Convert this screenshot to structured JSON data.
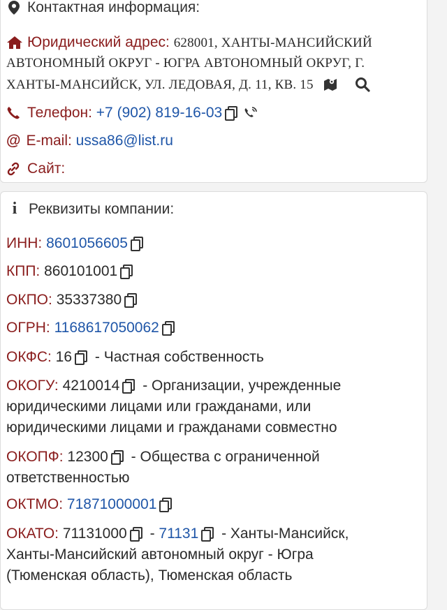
{
  "contact": {
    "header": "Контактная информация:",
    "address_label": "Юридический адрес:",
    "address_line1": "628001, ХАНТЫ-МАНСИЙСКИЙ",
    "address_line2": "АВТОНОМНЫЙ ОКРУГ - ЮГРА АВТОНОМНЫЙ ОКРУГ, Г.",
    "address_line3": "ХАНТЫ-МАНСИЙСК, УЛ. ЛЕДОВАЯ, Д. 11, КВ. 15",
    "phone_label": "Телефон:",
    "phone_value": "+7 (902) 819-16-03",
    "email_label": "E-mail:",
    "email_value": "ussa86@list.ru",
    "site_label": "Сайт:"
  },
  "requisites": {
    "header": "Реквизиты компании:",
    "inn_label": "ИНН:",
    "inn_value": "8601056605",
    "kpp_label": "КПП:",
    "kpp_value": "860101001",
    "okpo_label": "ОКПО:",
    "okpo_value": "35337380",
    "ogrn_label": "ОГРН:",
    "ogrn_value": "1168617050062",
    "okfs_label": "ОКФС:",
    "okfs_value": "16",
    "okfs_desc": "- Частная собственность",
    "okogu_label": "ОКОГУ:",
    "okogu_value": "4210014",
    "okogu_desc1": "- Организации, учрежденные",
    "okogu_desc2": "юридическими лицами или гражданами, или",
    "okogu_desc3": "юридическими лицами и гражданами совместно",
    "okopf_label": "ОКОПФ:",
    "okopf_value": "12300",
    "okopf_desc1": "- Общества с ограниченной",
    "okopf_desc2": "ответственностью",
    "oktmo_label": "ОКТМО:",
    "oktmo_value": "71871000001",
    "okato_label": "ОКАТО:",
    "okato_value": "71131000",
    "okato_dash": "-",
    "okato_code": "71131",
    "okato_desc1": "- Ханты-Мансийск,",
    "okato_desc2": "Ханты-Мансийский автономный округ - Югра",
    "okato_desc3": "(Тюменская область), Тюменская область"
  }
}
